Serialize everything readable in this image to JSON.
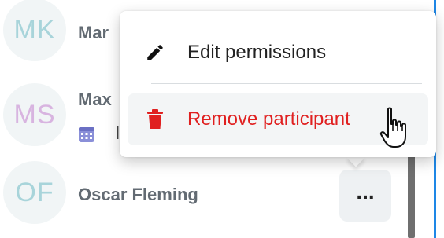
{
  "participants": [
    {
      "initials": "MK",
      "name": "Mar",
      "color": "#a8d4da"
    },
    {
      "initials": "MS",
      "name": "Max",
      "color": "#d8b4e0"
    },
    {
      "initials": "OF",
      "name": "Oscar Fleming",
      "color": "#a8d4da"
    }
  ],
  "second_row_meta": {
    "icon": "calendar-icon",
    "text": "l"
  },
  "more_button": {
    "label": "..."
  },
  "context_menu": {
    "items": [
      {
        "label": "Edit permissions",
        "icon": "pencil-icon"
      },
      {
        "label": "Remove participant",
        "icon": "trash-icon",
        "color": "#e02020"
      }
    ]
  },
  "colors": {
    "accent": "#1e87e6",
    "danger": "#e02020",
    "name_text": "#636b73"
  }
}
